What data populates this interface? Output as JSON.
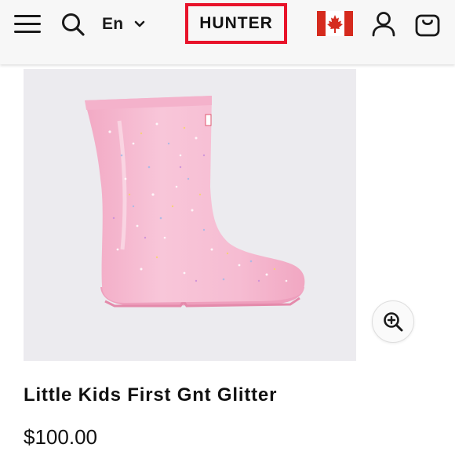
{
  "header": {
    "language": "En",
    "logo": "HUNTER",
    "colors": {
      "logo_border": "#e8132a",
      "flag_red": "#d52b1e"
    },
    "icons": [
      "menu-icon",
      "search-icon",
      "chevron-down-icon",
      "canada-flag-icon",
      "account-icon",
      "cart-icon"
    ]
  },
  "product": {
    "title": "Little Kids First Gnt Glitter",
    "price": "$100.00",
    "image": {
      "subject": "pink glitter kids rain boot",
      "background": "#ecebef",
      "boot_color": "#f6bcd2"
    },
    "zoom_icon": "zoom-in-icon"
  }
}
